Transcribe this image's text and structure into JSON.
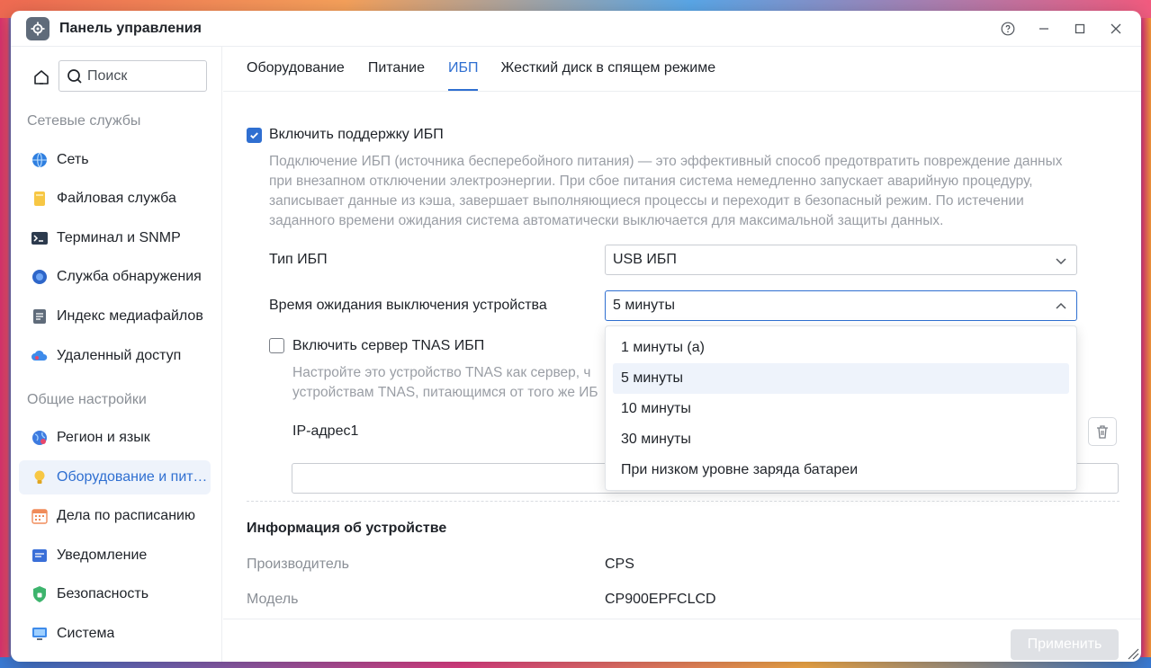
{
  "window": {
    "title": "Панель управления"
  },
  "sidebar": {
    "search_placeholder": "Поиск",
    "sections": [
      {
        "title": "Сетевые службы"
      },
      {
        "title": "Общие настройки"
      }
    ],
    "items": [
      {
        "label": "Сеть",
        "icon": "globe-icon"
      },
      {
        "label": "Файловая служба",
        "icon": "folder-icon"
      },
      {
        "label": "Терминал и SNMP",
        "icon": "terminal-icon"
      },
      {
        "label": "Служба обнаружения",
        "icon": "discovery-icon"
      },
      {
        "label": "Индекс медиафайлов",
        "icon": "media-index-icon"
      },
      {
        "label": "Удаленный доступ",
        "icon": "cloud-icon"
      },
      {
        "label": "Регион и язык",
        "icon": "region-icon"
      },
      {
        "label": "Оборудование и питание",
        "icon": "bulb-icon",
        "active": true
      },
      {
        "label": "Дела по расписанию",
        "icon": "calendar-icon"
      },
      {
        "label": "Уведомление",
        "icon": "notification-icon"
      },
      {
        "label": "Безопасность",
        "icon": "shield-icon"
      },
      {
        "label": "Система",
        "icon": "monitor-icon"
      }
    ]
  },
  "tabs": [
    {
      "label": "Оборудование"
    },
    {
      "label": "Питание"
    },
    {
      "label": "ИБП",
      "active": true
    },
    {
      "label": "Жесткий диск в спящем режиме"
    }
  ],
  "ups": {
    "enable_label": "Включить поддержку ИБП",
    "enable_checked": true,
    "description_lines": [
      "Подключение ИБП (источника бесперебойного питания) — это эффективный способ предотвратить повреждение данных",
      "при внезапном отключении электроэнергии. При сбое питания система немедленно запускает аварийную процедуру,",
      "записывает данные из кэша, завершает выполняющиеся процессы и переходит в безопасный режим. По истечении",
      "заданного времени ожидания система автоматически выключается для максимальной защиты данных."
    ],
    "type_label": "Тип ИБП",
    "type_value": "USB ИБП",
    "timeout_label": "Время ожидания выключения устройства",
    "timeout_value": "5 минуты",
    "timeout_options": [
      "1 минуты (а)",
      "5 минуты",
      "10 минуты",
      "30 минуты",
      "При низком уровне заряда батареи"
    ],
    "server_label": "Включить сервер TNAS ИБП",
    "server_checked": false,
    "server_desc_lines": [
      "Настройте это устройство TNAS как сервер, ч",
      "устройствам TNAS, питающимся от того же ИБ"
    ],
    "ip_label": "IP-адрес1",
    "ip_value": ""
  },
  "device_info": {
    "title": "Информация об устройстве",
    "manufacturer_label": "Производитель",
    "manufacturer_value": "CPS",
    "model_label": "Модель",
    "model_value": "CP900EPFCLCD"
  },
  "footer": {
    "apply_label": "Применить"
  },
  "colors": {
    "accent": "#2f6fd1",
    "muted": "#8a8f96"
  }
}
